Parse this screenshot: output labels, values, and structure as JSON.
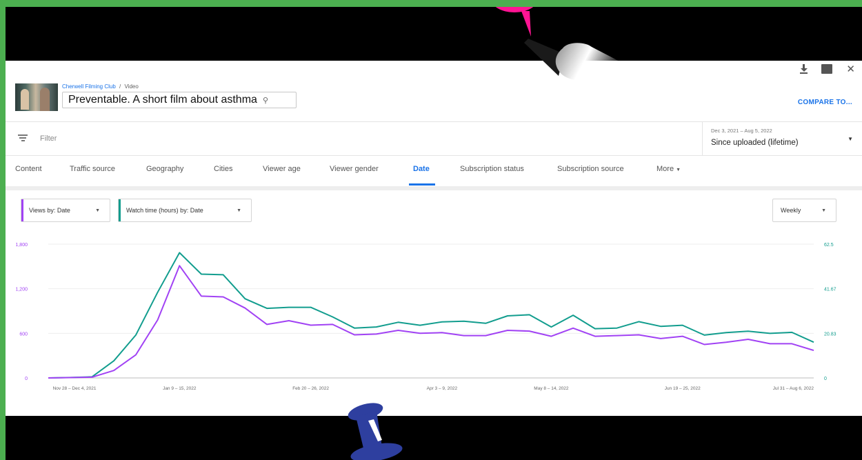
{
  "header": {
    "channel": "Cherwell Filming Club",
    "separator": "/",
    "section": "Video",
    "video_title": "Preventable. A short film about asthma",
    "compare_label": "COMPARE TO..."
  },
  "filter": {
    "placeholder": "Filter"
  },
  "date_range": {
    "range": "Dec 3, 2021 – Aug 5, 2022",
    "label": "Since uploaded (lifetime)"
  },
  "tabs": [
    {
      "label": "Content"
    },
    {
      "label": "Traffic source"
    },
    {
      "label": "Geography"
    },
    {
      "label": "Cities"
    },
    {
      "label": "Viewer age"
    },
    {
      "label": "Viewer gender"
    },
    {
      "label": "Date",
      "active": true
    },
    {
      "label": "Subscription status"
    },
    {
      "label": "Subscription source"
    },
    {
      "label": "More"
    }
  ],
  "metric_selectors": {
    "primary": {
      "label": "Views by: Date",
      "color": "#a142f4"
    },
    "secondary": {
      "label": "Watch time (hours) by: Date",
      "color": "#129d8e"
    },
    "interval": "Weekly"
  },
  "chart_data": {
    "type": "line",
    "x_ticks": [
      "Nov 28 – Dec 4, 2021",
      "Jan 9 – 15, 2022",
      "Feb 20 – 26, 2022",
      "Apr 3 – 9, 2022",
      "May 8 – 14, 2022",
      "Jun 19 – 25, 2022",
      "Jul 31 – Aug 6, 2022"
    ],
    "left_axis": {
      "ticks": [
        "0",
        "600",
        "1,200",
        "1,800"
      ],
      "ylim": [
        0,
        1800
      ],
      "color": "#a142f4"
    },
    "right_axis": {
      "ticks": [
        "0",
        "20.83",
        "41.67",
        "62.5"
      ],
      "ylim": [
        0,
        62.5
      ],
      "color": "#129d8e"
    },
    "grid": true,
    "series": [
      {
        "name": "Views",
        "axis": "left",
        "color": "#a142f4",
        "values": [
          0,
          5,
          10,
          100,
          310,
          780,
          1510,
          1100,
          1090,
          940,
          720,
          770,
          710,
          720,
          580,
          590,
          640,
          600,
          610,
          570,
          570,
          640,
          630,
          560,
          670,
          560,
          570,
          580,
          530,
          560,
          450,
          480,
          520,
          460,
          460,
          370
        ]
      },
      {
        "name": "Watch time (hours)",
        "axis": "right",
        "color": "#129d8e",
        "values": [
          0,
          0.2,
          0.5,
          8,
          20,
          40,
          58.5,
          48.5,
          48.2,
          37,
          32.5,
          33,
          33,
          28.5,
          23.3,
          23.8,
          26,
          24.6,
          26.2,
          26.5,
          25.5,
          29,
          29.5,
          23.8,
          29.3,
          23,
          23.3,
          26.3,
          24.1,
          24.6,
          20,
          21.2,
          21.8,
          20.8,
          21.3,
          16.7
        ]
      }
    ]
  }
}
